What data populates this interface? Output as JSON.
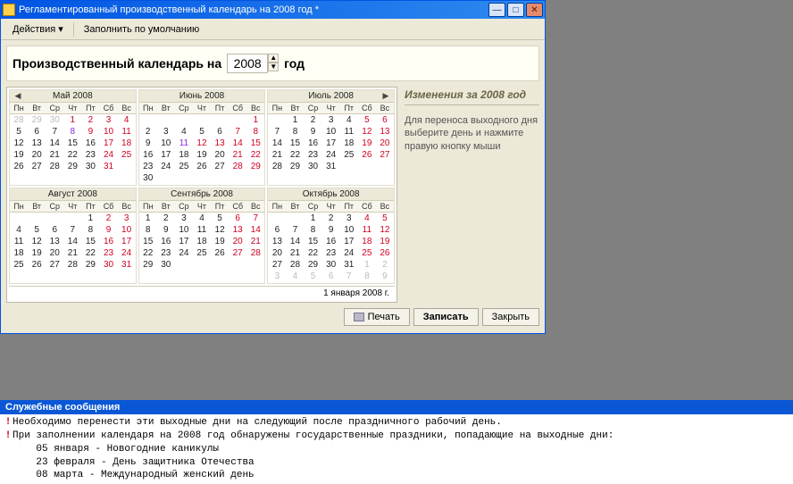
{
  "window": {
    "title": "Регламентированный производственный календарь на 2008 год *"
  },
  "toolbar": {
    "actions": "Действия",
    "fill_default": "Заполнить по умолчанию"
  },
  "header": {
    "label": "Производственный календарь на",
    "year": "2008",
    "suffix": "год"
  },
  "side": {
    "title": "Изменения за 2008 год",
    "text": "Для переноса выходного дня выберите день и нажмите правую кнопку мыши"
  },
  "footer_date": "1 января 2008 г.",
  "buttons": {
    "print": "Печать",
    "save": "Записать",
    "close": "Закрыть"
  },
  "dow": [
    "Пн",
    "Вт",
    "Ср",
    "Чт",
    "Пт",
    "Сб",
    "Вс"
  ],
  "months": [
    {
      "title": "Май 2008",
      "nav": "left",
      "weeks": [
        [
          {
            "d": "28",
            "c": "out"
          },
          {
            "d": "29",
            "c": "out"
          },
          {
            "d": "30",
            "c": "out"
          },
          {
            "d": "1",
            "c": "red"
          },
          {
            "d": "2",
            "c": "red"
          },
          {
            "d": "3",
            "c": "red"
          },
          {
            "d": "4",
            "c": "red"
          }
        ],
        [
          {
            "d": "5"
          },
          {
            "d": "6"
          },
          {
            "d": "7"
          },
          {
            "d": "8",
            "c": "purple"
          },
          {
            "d": "9",
            "c": "red"
          },
          {
            "d": "10",
            "c": "red"
          },
          {
            "d": "11",
            "c": "red"
          }
        ],
        [
          {
            "d": "12"
          },
          {
            "d": "13"
          },
          {
            "d": "14"
          },
          {
            "d": "15"
          },
          {
            "d": "16"
          },
          {
            "d": "17",
            "c": "red"
          },
          {
            "d": "18",
            "c": "red"
          }
        ],
        [
          {
            "d": "19"
          },
          {
            "d": "20"
          },
          {
            "d": "21"
          },
          {
            "d": "22"
          },
          {
            "d": "23"
          },
          {
            "d": "24",
            "c": "red"
          },
          {
            "d": "25",
            "c": "red"
          }
        ],
        [
          {
            "d": "26"
          },
          {
            "d": "27"
          },
          {
            "d": "28"
          },
          {
            "d": "29"
          },
          {
            "d": "30"
          },
          {
            "d": "31",
            "c": "red"
          },
          {
            "d": ""
          }
        ]
      ]
    },
    {
      "title": "Июнь 2008",
      "weeks": [
        [
          {
            "d": ""
          },
          {
            "d": ""
          },
          {
            "d": ""
          },
          {
            "d": ""
          },
          {
            "d": ""
          },
          {
            "d": ""
          },
          {
            "d": "1",
            "c": "red"
          }
        ],
        [
          {
            "d": "2"
          },
          {
            "d": "3"
          },
          {
            "d": "4"
          },
          {
            "d": "5"
          },
          {
            "d": "6"
          },
          {
            "d": "7",
            "c": "red"
          },
          {
            "d": "8",
            "c": "red"
          }
        ],
        [
          {
            "d": "9"
          },
          {
            "d": "10"
          },
          {
            "d": "11",
            "c": "purple"
          },
          {
            "d": "12",
            "c": "red"
          },
          {
            "d": "13",
            "c": "red"
          },
          {
            "d": "14",
            "c": "red"
          },
          {
            "d": "15",
            "c": "red"
          }
        ],
        [
          {
            "d": "16"
          },
          {
            "d": "17"
          },
          {
            "d": "18"
          },
          {
            "d": "19"
          },
          {
            "d": "20"
          },
          {
            "d": "21",
            "c": "red"
          },
          {
            "d": "22",
            "c": "red"
          }
        ],
        [
          {
            "d": "23"
          },
          {
            "d": "24"
          },
          {
            "d": "25"
          },
          {
            "d": "26"
          },
          {
            "d": "27"
          },
          {
            "d": "28",
            "c": "red"
          },
          {
            "d": "29",
            "c": "red"
          }
        ],
        [
          {
            "d": "30"
          },
          {
            "d": ""
          },
          {
            "d": ""
          },
          {
            "d": ""
          },
          {
            "d": ""
          },
          {
            "d": ""
          },
          {
            "d": ""
          }
        ]
      ]
    },
    {
      "title": "Июль 2008",
      "nav": "right",
      "weeks": [
        [
          {
            "d": ""
          },
          {
            "d": "1"
          },
          {
            "d": "2"
          },
          {
            "d": "3"
          },
          {
            "d": "4"
          },
          {
            "d": "5",
            "c": "red"
          },
          {
            "d": "6",
            "c": "red"
          }
        ],
        [
          {
            "d": "7"
          },
          {
            "d": "8"
          },
          {
            "d": "9"
          },
          {
            "d": "10"
          },
          {
            "d": "11"
          },
          {
            "d": "12",
            "c": "red"
          },
          {
            "d": "13",
            "c": "red"
          }
        ],
        [
          {
            "d": "14"
          },
          {
            "d": "15"
          },
          {
            "d": "16"
          },
          {
            "d": "17"
          },
          {
            "d": "18"
          },
          {
            "d": "19",
            "c": "red"
          },
          {
            "d": "20",
            "c": "red"
          }
        ],
        [
          {
            "d": "21"
          },
          {
            "d": "22"
          },
          {
            "d": "23"
          },
          {
            "d": "24"
          },
          {
            "d": "25"
          },
          {
            "d": "26",
            "c": "red"
          },
          {
            "d": "27",
            "c": "red"
          }
        ],
        [
          {
            "d": "28"
          },
          {
            "d": "29"
          },
          {
            "d": "30"
          },
          {
            "d": "31"
          },
          {
            "d": ""
          },
          {
            "d": ""
          },
          {
            "d": ""
          }
        ]
      ]
    },
    {
      "title": "Август 2008",
      "weeks": [
        [
          {
            "d": ""
          },
          {
            "d": ""
          },
          {
            "d": ""
          },
          {
            "d": ""
          },
          {
            "d": "1"
          },
          {
            "d": "2",
            "c": "red"
          },
          {
            "d": "3",
            "c": "red"
          }
        ],
        [
          {
            "d": "4"
          },
          {
            "d": "5"
          },
          {
            "d": "6"
          },
          {
            "d": "7"
          },
          {
            "d": "8"
          },
          {
            "d": "9",
            "c": "red"
          },
          {
            "d": "10",
            "c": "red"
          }
        ],
        [
          {
            "d": "11"
          },
          {
            "d": "12"
          },
          {
            "d": "13"
          },
          {
            "d": "14"
          },
          {
            "d": "15"
          },
          {
            "d": "16",
            "c": "red"
          },
          {
            "d": "17",
            "c": "red"
          }
        ],
        [
          {
            "d": "18"
          },
          {
            "d": "19"
          },
          {
            "d": "20"
          },
          {
            "d": "21"
          },
          {
            "d": "22"
          },
          {
            "d": "23",
            "c": "red"
          },
          {
            "d": "24",
            "c": "red"
          }
        ],
        [
          {
            "d": "25"
          },
          {
            "d": "26"
          },
          {
            "d": "27"
          },
          {
            "d": "28"
          },
          {
            "d": "29"
          },
          {
            "d": "30",
            "c": "red"
          },
          {
            "d": "31",
            "c": "red"
          }
        ]
      ]
    },
    {
      "title": "Сентябрь 2008",
      "weeks": [
        [
          {
            "d": "1"
          },
          {
            "d": "2"
          },
          {
            "d": "3"
          },
          {
            "d": "4"
          },
          {
            "d": "5"
          },
          {
            "d": "6",
            "c": "red"
          },
          {
            "d": "7",
            "c": "red"
          }
        ],
        [
          {
            "d": "8"
          },
          {
            "d": "9"
          },
          {
            "d": "10"
          },
          {
            "d": "11"
          },
          {
            "d": "12"
          },
          {
            "d": "13",
            "c": "red"
          },
          {
            "d": "14",
            "c": "red"
          }
        ],
        [
          {
            "d": "15"
          },
          {
            "d": "16"
          },
          {
            "d": "17"
          },
          {
            "d": "18"
          },
          {
            "d": "19"
          },
          {
            "d": "20",
            "c": "red"
          },
          {
            "d": "21",
            "c": "red"
          }
        ],
        [
          {
            "d": "22"
          },
          {
            "d": "23"
          },
          {
            "d": "24"
          },
          {
            "d": "25"
          },
          {
            "d": "26"
          },
          {
            "d": "27",
            "c": "red"
          },
          {
            "d": "28",
            "c": "red"
          }
        ],
        [
          {
            "d": "29"
          },
          {
            "d": "30"
          },
          {
            "d": ""
          },
          {
            "d": ""
          },
          {
            "d": ""
          },
          {
            "d": ""
          },
          {
            "d": ""
          }
        ]
      ]
    },
    {
      "title": "Октябрь 2008",
      "weeks": [
        [
          {
            "d": ""
          },
          {
            "d": ""
          },
          {
            "d": "1"
          },
          {
            "d": "2"
          },
          {
            "d": "3"
          },
          {
            "d": "4",
            "c": "red"
          },
          {
            "d": "5",
            "c": "red"
          }
        ],
        [
          {
            "d": "6"
          },
          {
            "d": "7"
          },
          {
            "d": "8"
          },
          {
            "d": "9"
          },
          {
            "d": "10"
          },
          {
            "d": "11",
            "c": "red"
          },
          {
            "d": "12",
            "c": "red"
          }
        ],
        [
          {
            "d": "13"
          },
          {
            "d": "14"
          },
          {
            "d": "15"
          },
          {
            "d": "16"
          },
          {
            "d": "17"
          },
          {
            "d": "18",
            "c": "red"
          },
          {
            "d": "19",
            "c": "red"
          }
        ],
        [
          {
            "d": "20"
          },
          {
            "d": "21"
          },
          {
            "d": "22"
          },
          {
            "d": "23"
          },
          {
            "d": "24"
          },
          {
            "d": "25",
            "c": "red"
          },
          {
            "d": "26",
            "c": "red"
          }
        ],
        [
          {
            "d": "27"
          },
          {
            "d": "28"
          },
          {
            "d": "29"
          },
          {
            "d": "30"
          },
          {
            "d": "31"
          },
          {
            "d": "1",
            "c": "out"
          },
          {
            "d": "2",
            "c": "out"
          }
        ],
        [
          {
            "d": "3",
            "c": "out"
          },
          {
            "d": "4",
            "c": "out"
          },
          {
            "d": "5",
            "c": "out"
          },
          {
            "d": "6",
            "c": "out"
          },
          {
            "d": "7",
            "c": "out"
          },
          {
            "d": "8",
            "c": "out"
          },
          {
            "d": "9",
            "c": "out"
          }
        ]
      ]
    }
  ],
  "messages": {
    "title": "Служебные сообщения",
    "lines": [
      {
        "mark": "!",
        "text": "Необходимо перенести эти выходные дни на следующий после праздничного рабочий день."
      },
      {
        "mark": "!",
        "text": "При заполнении календаря на 2008 год обнаружены государственные праздники, попадающие на выходные дни:"
      },
      {
        "mark": "",
        "text": "    05 января - Новогодние каникулы"
      },
      {
        "mark": "",
        "text": "    23 февраля - День защитника Отечества"
      },
      {
        "mark": "",
        "text": "    08 марта - Международный женский день"
      }
    ]
  }
}
